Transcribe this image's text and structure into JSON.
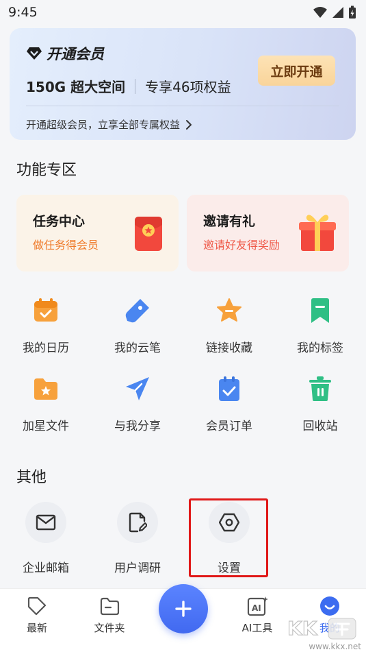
{
  "status_bar": {
    "time": "9:45"
  },
  "vip": {
    "title": "开通会员",
    "space": "150G 超大空间",
    "benefits": "专享46项权益",
    "open_button": "立即开通",
    "description": "开通超级会员，立享全部专属权益"
  },
  "features": {
    "title": "功能专区",
    "task_card": {
      "title": "任务中心",
      "subtitle": "做任务得会员"
    },
    "invite_card": {
      "title": "邀请有礼",
      "subtitle": "邀请好友得奖励"
    },
    "grid": [
      {
        "label": "我的日历",
        "icon": "calendar-icon"
      },
      {
        "label": "我的云笔",
        "icon": "cloud-pen-icon"
      },
      {
        "label": "链接收藏",
        "icon": "star-icon"
      },
      {
        "label": "我的标签",
        "icon": "bookmark-icon"
      },
      {
        "label": "加星文件",
        "icon": "starred-folder-icon"
      },
      {
        "label": "与我分享",
        "icon": "send-icon"
      },
      {
        "label": "会员订单",
        "icon": "order-clipboard-icon"
      },
      {
        "label": "回收站",
        "icon": "trash-icon"
      }
    ]
  },
  "other": {
    "title": "其他",
    "items": [
      {
        "label": "企业邮箱",
        "icon": "mail-icon"
      },
      {
        "label": "用户调研",
        "icon": "survey-icon"
      },
      {
        "label": "设置",
        "icon": "settings-icon"
      }
    ]
  },
  "bottom_nav": {
    "items": [
      {
        "label": "最新",
        "icon": "tag-icon"
      },
      {
        "label": "文件夹",
        "icon": "folder-icon"
      },
      {
        "label": "AI工具",
        "icon": "ai-icon"
      },
      {
        "label": "我的",
        "icon": "profile-icon"
      }
    ],
    "active_index": 3
  },
  "watermark": {
    "text": "www.kkx.net",
    "logo": "KK下载"
  },
  "colors": {
    "accent": "#4169f0",
    "highlight": "#e01818",
    "task_orange": "#ef7a29",
    "invite_red": "#ef5a4a",
    "feature_orange": "#f7a13c",
    "feature_blue": "#4a86f0",
    "feature_green": "#2fbf85"
  }
}
